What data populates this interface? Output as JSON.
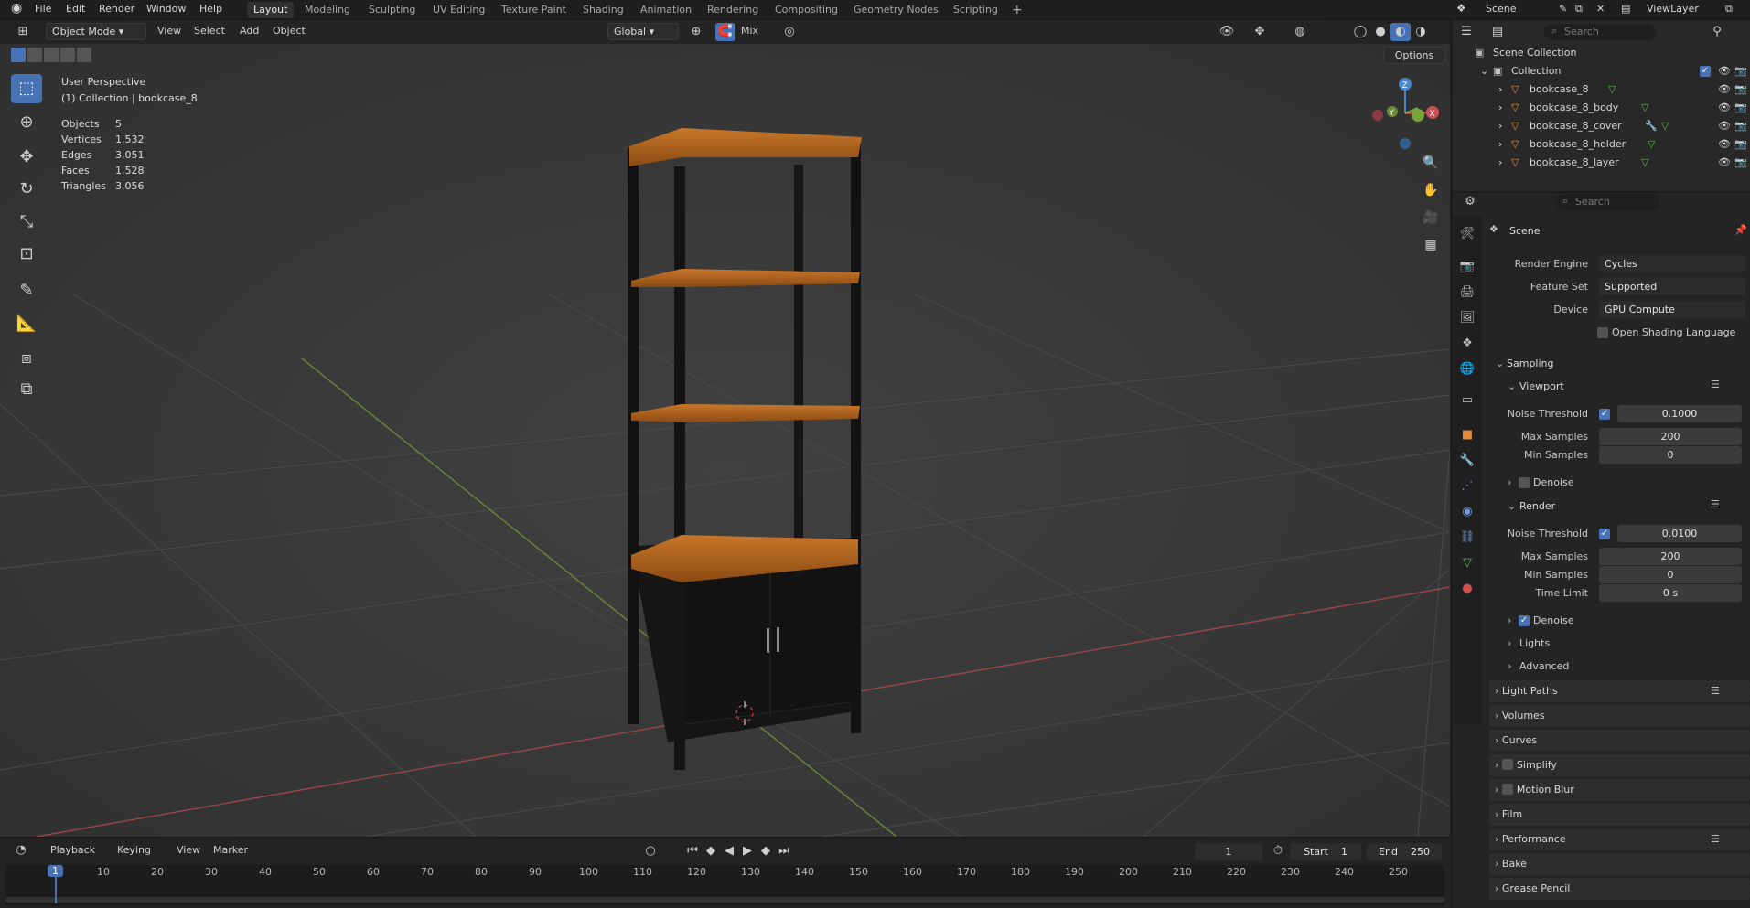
{
  "topbar": {
    "menus": [
      "File",
      "Edit",
      "Render",
      "Window",
      "Help"
    ],
    "workspaces": [
      "Layout",
      "Modeling",
      "Sculpting",
      "UV Editing",
      "Texture Paint",
      "Shading",
      "Animation",
      "Rendering",
      "Compositing",
      "Geometry Nodes",
      "Scripting"
    ],
    "add": "+",
    "scene": "Scene",
    "view_layer": "ViewLayer"
  },
  "viewport_header": {
    "mode": "Object Mode",
    "menus": [
      "View",
      "Select",
      "Add",
      "Object"
    ],
    "orientation": "Global",
    "mix": "Mix",
    "options": "Options"
  },
  "overlay": {
    "perspective": "User Perspective",
    "context": "(1) Collection | bookcase_8",
    "stats": [
      {
        "label": "Objects",
        "value": "5"
      },
      {
        "label": "Vertices",
        "value": "1,532"
      },
      {
        "label": "Edges",
        "value": "3,051"
      },
      {
        "label": "Faces",
        "value": "1,528"
      },
      {
        "label": "Triangles",
        "value": "3,056"
      }
    ]
  },
  "gizmo": {
    "z": "Z",
    "y": "Y",
    "x": "X"
  },
  "outliner": {
    "search_placeholder": "Search",
    "scene_collection": "Scene Collection",
    "collection": "Collection",
    "items": [
      "bookcase_8",
      "bookcase_8_body",
      "bookcase_8_cover",
      "bookcase_8_holder",
      "bookcase_8_layer"
    ]
  },
  "properties": {
    "search_placeholder": "Search",
    "context": "Scene",
    "render_engine": {
      "label": "Render Engine",
      "value": "Cycles"
    },
    "feature_set": {
      "label": "Feature Set",
      "value": "Supported"
    },
    "device": {
      "label": "Device",
      "value": "GPU Compute"
    },
    "osl": "Open Shading Language",
    "sampling": "Sampling",
    "viewport": {
      "title": "Viewport",
      "noise_label": "Noise Threshold",
      "noise": "0.1000",
      "max_label": "Max Samples",
      "max": "200",
      "min_label": "Min Samples",
      "min": "0",
      "denoise": "Denoise"
    },
    "render": {
      "title": "Render",
      "noise_label": "Noise Threshold",
      "noise": "0.0100",
      "max_label": "Max Samples",
      "max": "200",
      "min_label": "Min Samples",
      "min": "0",
      "time_label": "Time Limit",
      "time": "0 s",
      "denoise": "Denoise"
    },
    "subpanels": [
      "Lights",
      "Advanced"
    ],
    "panels": [
      "Light Paths",
      "Volumes",
      "Curves",
      "Simplify",
      "Motion Blur",
      "Film",
      "Performance",
      "Bake",
      "Grease Pencil"
    ]
  },
  "timeline": {
    "menus": [
      "Playback",
      "Keying",
      "View",
      "Marker"
    ],
    "current_frame": "1",
    "start_label": "Start",
    "start": "1",
    "end_label": "End",
    "end": "250",
    "ticks": [
      "1",
      "10",
      "20",
      "30",
      "40",
      "50",
      "60",
      "70",
      "80",
      "90",
      "100",
      "110",
      "120",
      "130",
      "140",
      "150",
      "160",
      "170",
      "180",
      "190",
      "200",
      "210",
      "220",
      "230",
      "240",
      "250"
    ]
  },
  "colors": {
    "accent": "#4772b3",
    "x_axis": "#c94f55",
    "y_axis": "#7aa53b",
    "z_axis": "#4a85c9",
    "wood": "#b5661e"
  }
}
